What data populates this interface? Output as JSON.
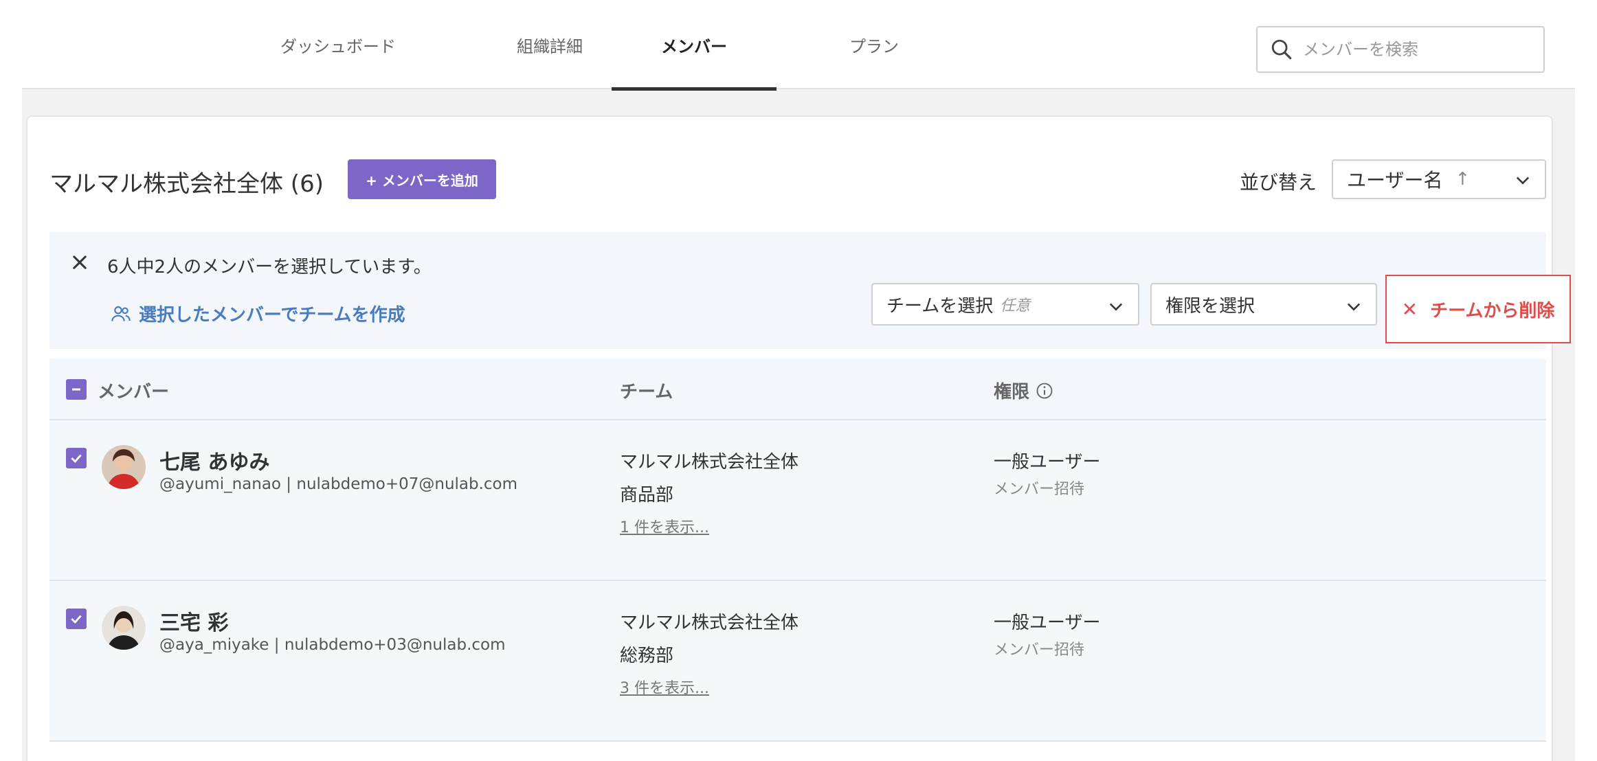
{
  "nav": {
    "tabs": [
      {
        "label": "ダッシュボード"
      },
      {
        "label": "組織詳細"
      },
      {
        "label": "メンバー"
      },
      {
        "label": "プラン"
      }
    ],
    "active_tab": "メンバー",
    "search_placeholder": "メンバーを検索"
  },
  "header": {
    "org_title": "マルマル株式会社全体 (6)",
    "add_member_label": "+ メンバーを追加",
    "sort_label": "並び替え",
    "sort_value": "ユーザー名",
    "sort_direction_icon": "↑"
  },
  "selection": {
    "message": "6人中2人のメンバーを選択しています。",
    "create_team_label": "選択したメンバーでチームを作成",
    "team_select_label": "チームを選択",
    "team_select_optional": "任意",
    "role_select_label": "権限を選択",
    "remove_label": "チームから削除"
  },
  "table": {
    "headers": {
      "member": "メンバー",
      "team": "チーム",
      "role": "権限"
    },
    "rows": [
      {
        "name": "七尾 あゆみ",
        "handle_email": "@ayumi_nanao | nulabdemo+07@nulab.com",
        "teams": [
          "マルマル株式会社全体",
          "商品部"
        ],
        "more": "1 件を表示...",
        "role": "一般ユーザー",
        "role_sub": "メンバー招待",
        "checked": true
      },
      {
        "name": "三宅 彩",
        "handle_email": "@aya_miyake | nulabdemo+03@nulab.com",
        "teams": [
          "マルマル株式会社全体",
          "総務部"
        ],
        "more": "3 件を表示...",
        "role": "一般ユーザー",
        "role_sub": "メンバー招待",
        "checked": true
      }
    ]
  },
  "colors": {
    "accent": "#7c67c9",
    "danger": "#e34b4b",
    "link": "#4a7bbf"
  }
}
